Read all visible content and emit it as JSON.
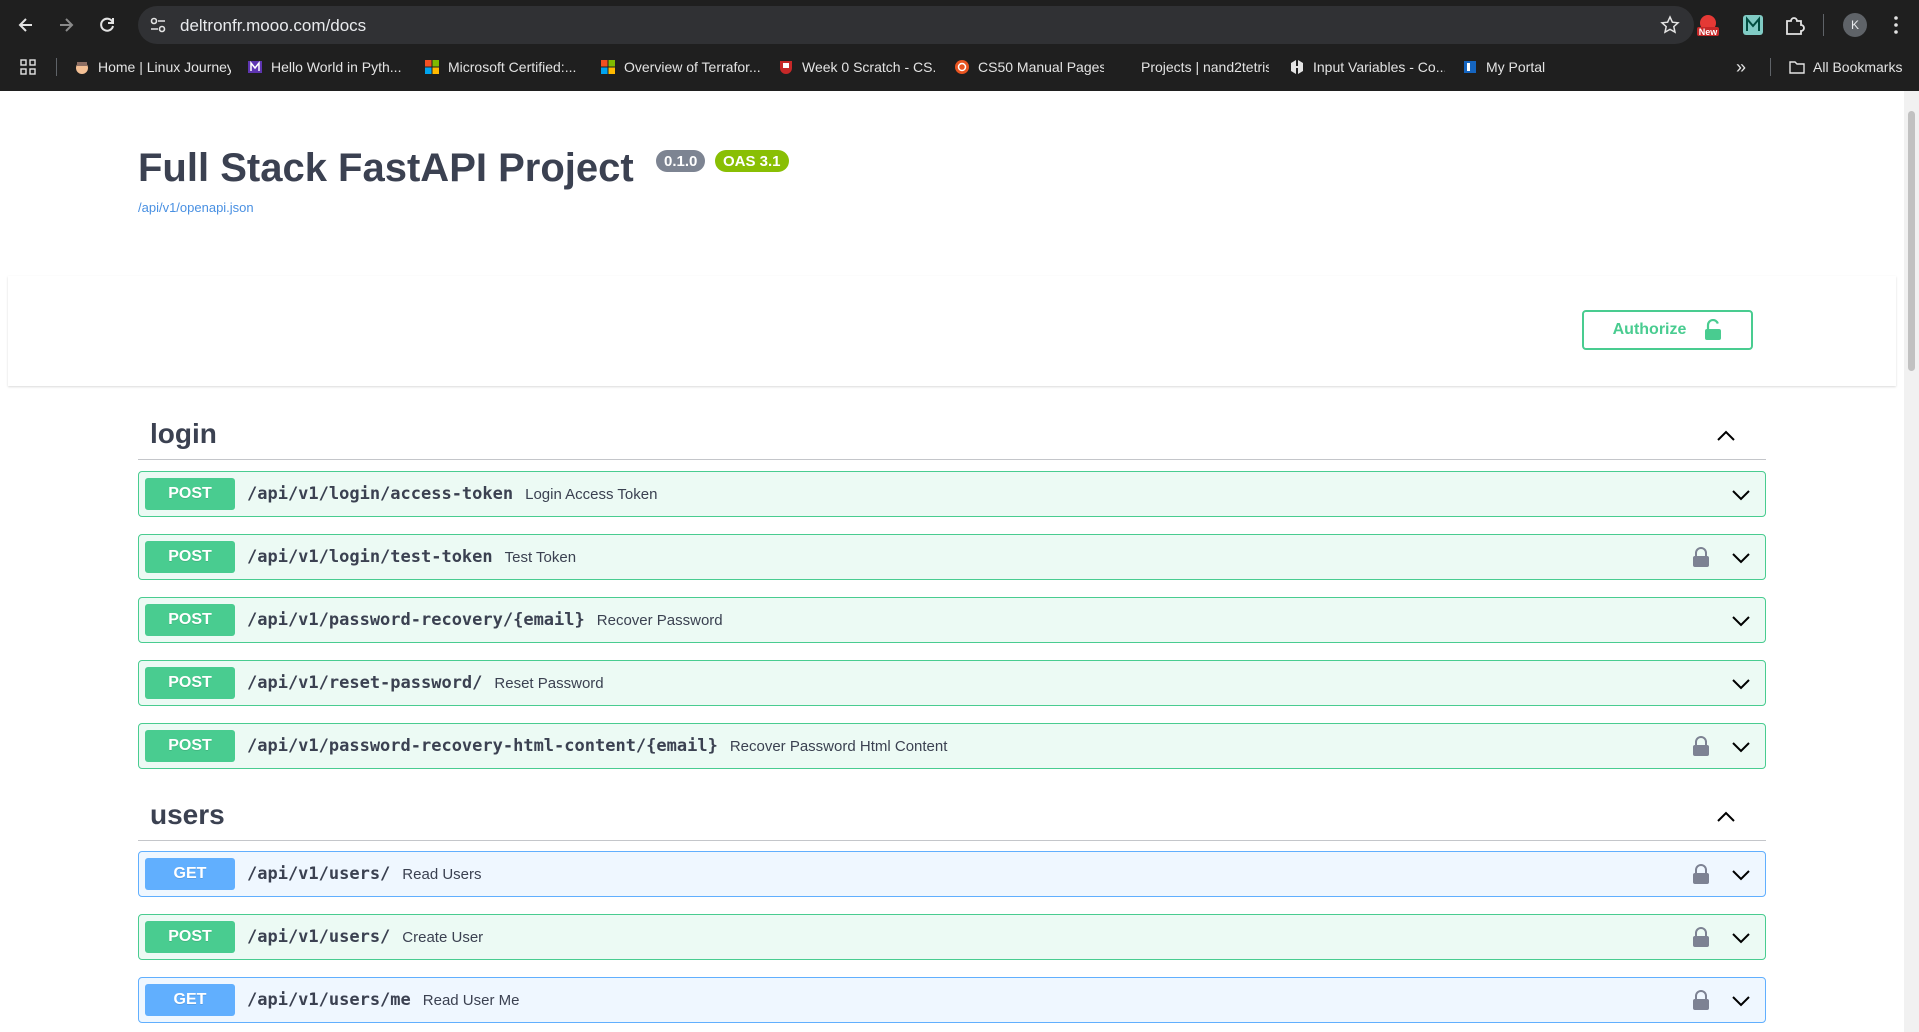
{
  "browser": {
    "url": "deltronfr.mooo.com/docs",
    "profile_initial": "K",
    "ext_badge": "New",
    "bookmarks": [
      {
        "label": "Home | Linux Journey"
      },
      {
        "label": "Hello World in Pyth..."
      },
      {
        "label": "Microsoft Certified:..."
      },
      {
        "label": "Overview of Terrafor..."
      },
      {
        "label": "Week 0 Scratch - CS..."
      },
      {
        "label": "CS50 Manual Pages"
      },
      {
        "label": "Projects | nand2tetris"
      },
      {
        "label": "Input Variables - Co..."
      },
      {
        "label": "My Portal"
      }
    ],
    "more_bookmarks": "»",
    "all_bookmarks": "All Bookmarks"
  },
  "info": {
    "title": "Full Stack FastAPI Project",
    "version": "0.1.0",
    "oas": "OAS 3.1",
    "spec_url": "/api/v1/openapi.json"
  },
  "authorize": {
    "label": "Authorize"
  },
  "tags": [
    {
      "name": "login",
      "operations": [
        {
          "method": "POST",
          "path": "/api/v1/login/access-token",
          "summary": "Login Access Token",
          "locked": false
        },
        {
          "method": "POST",
          "path": "/api/v1/login/test-token",
          "summary": "Test Token",
          "locked": true
        },
        {
          "method": "POST",
          "path": "/api/v1/password-recovery/{email}",
          "summary": "Recover Password",
          "locked": false
        },
        {
          "method": "POST",
          "path": "/api/v1/reset-password/",
          "summary": "Reset Password",
          "locked": false
        },
        {
          "method": "POST",
          "path": "/api/v1/password-recovery-html-content/{email}",
          "summary": "Recover Password Html Content",
          "locked": true
        }
      ]
    },
    {
      "name": "users",
      "operations": [
        {
          "method": "GET",
          "path": "/api/v1/users/",
          "summary": "Read Users",
          "locked": true
        },
        {
          "method": "POST",
          "path": "/api/v1/users/",
          "summary": "Create User",
          "locked": true
        },
        {
          "method": "GET",
          "path": "/api/v1/users/me",
          "summary": "Read User Me",
          "locked": true
        }
      ]
    }
  ],
  "colors": {
    "post": "#49cc90",
    "get": "#61affe",
    "text": "#3b4151"
  }
}
